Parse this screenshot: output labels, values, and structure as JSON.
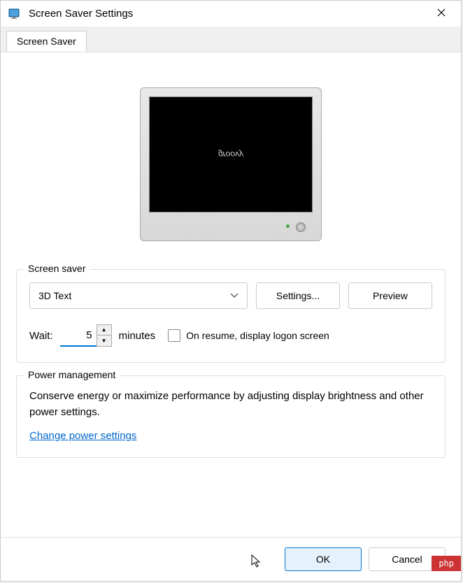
{
  "window": {
    "title": "Screen Saver Settings"
  },
  "tabs": [
    {
      "label": "Screen Saver"
    }
  ],
  "preview": {
    "text": "groovy"
  },
  "screensaver": {
    "legend": "Screen saver",
    "selected": "3D Text",
    "settings_btn": "Settings...",
    "preview_btn": "Preview",
    "wait_label": "Wait:",
    "wait_value": "5",
    "minutes_label": "minutes",
    "resume_label": "On resume, display logon screen",
    "resume_checked": false
  },
  "power": {
    "legend": "Power management",
    "description": "Conserve energy or maximize performance by adjusting display brightness and other power settings.",
    "link": "Change power settings"
  },
  "footer": {
    "ok": "OK",
    "cancel": "Cancel"
  },
  "watermark": "php"
}
